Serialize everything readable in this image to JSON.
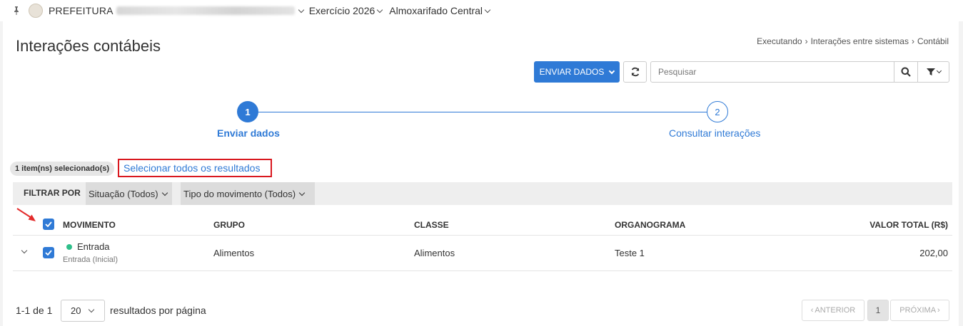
{
  "topbar": {
    "org_label": "PREFEITURA",
    "exercise": "Exercício 2026",
    "warehouse": "Almoxarifado Central"
  },
  "page": {
    "title": "Interações contábeis",
    "breadcrumb": [
      "Executando",
      "Interações entre sistemas",
      "Contábil"
    ]
  },
  "toolbar": {
    "send_label": "ENVIAR DADOS",
    "search_placeholder": "Pesquisar"
  },
  "stepper": {
    "steps": [
      {
        "number": "1",
        "label": "Enviar dados"
      },
      {
        "number": "2",
        "label": "Consultar interações"
      }
    ]
  },
  "selection": {
    "badge": "1 item(ns) selecionado(s)",
    "select_all": "Selecionar todos os resultados"
  },
  "filters": {
    "label": "FILTRAR POR",
    "chips": [
      "Situação (Todos)",
      "Tipo do movimento (Todos)"
    ]
  },
  "table": {
    "columns": [
      "MOVIMENTO",
      "GRUPO",
      "CLASSE",
      "ORGANOGRAMA",
      "VALOR TOTAL (R$)"
    ],
    "rows": [
      {
        "movimento": "Entrada",
        "movimento_sub": "Entrada (Inicial)",
        "grupo": "Alimentos",
        "classe": "Alimentos",
        "organograma": "Teste 1",
        "valor": "202,00"
      }
    ]
  },
  "pagination": {
    "info": "1-1 de 1",
    "per_page": "20",
    "per_page_label": "resultados por página",
    "prev": "ANTERIOR",
    "current": "1",
    "next": "PRÓXIMA"
  },
  "colors": {
    "primary": "#2f7ad6",
    "highlight_border": "#d9181f",
    "status_green": "#2fbf8a"
  }
}
